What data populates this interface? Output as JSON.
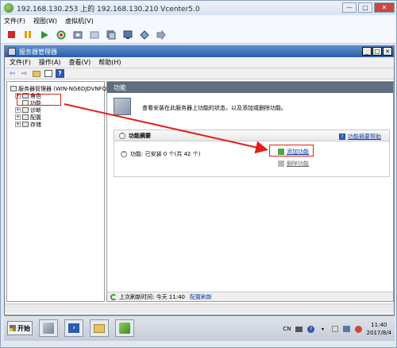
{
  "window": {
    "title": "192.168.130.253 上的 192.168.130.210 Vcenter5.0",
    "controls": [
      "—",
      "□",
      "✕"
    ]
  },
  "client_menu": [
    "文件(F)",
    "视图(W)",
    "虚拟机(V)"
  ],
  "guest": {
    "title": "服务器管理器",
    "menu": [
      "文件(F)",
      "操作(A)",
      "查看(V)",
      "帮助(H)"
    ],
    "tree": {
      "root": "服务器管理器 (WIN-NG6DJDVNFQ",
      "items": [
        "角色",
        "功能",
        "诊断",
        "配置",
        "存储"
      ]
    },
    "content": {
      "header": "功能",
      "intro": "查看安装在此服务器上功能的状态，以及添加或删除功能。",
      "summary_title": "功能摘要",
      "summary_help": "功能摘要帮助",
      "features_row": "功能: 已安装 0 个(共 42 个)",
      "add_features": "添加功能",
      "remove_features": "删除功能",
      "status_label": "上次刷新时间: 今天 11:40",
      "status_link": "配置刷新"
    }
  },
  "taskbar": {
    "start": "开始",
    "lang": "CN",
    "time": "11:40",
    "date": "2017/8/4"
  },
  "colors": {
    "annotation_red": "#e0201a",
    "title_blue": "#2a5ca8",
    "section_header": "#5f6d7e"
  }
}
